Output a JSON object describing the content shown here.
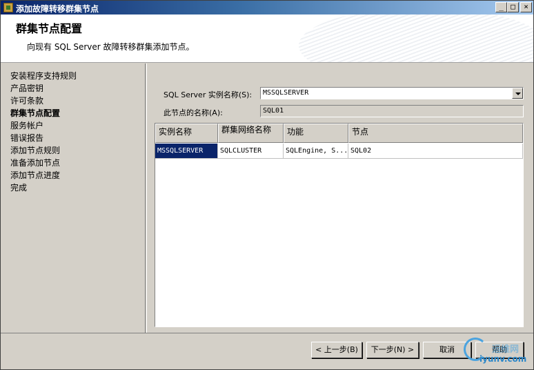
{
  "window": {
    "title": "添加故障转移群集节点"
  },
  "header": {
    "title": "群集节点配置",
    "subtitle": "向现有 SQL Server 故障转移群集添加节点。"
  },
  "nav": {
    "items": [
      {
        "label": "安装程序支持规则"
      },
      {
        "label": "产品密钥"
      },
      {
        "label": "许可条款"
      },
      {
        "label": "群集节点配置",
        "active": true
      },
      {
        "label": "服务帐户"
      },
      {
        "label": "错误报告"
      },
      {
        "label": "添加节点规则"
      },
      {
        "label": "准备添加节点"
      },
      {
        "label": "添加节点进度"
      },
      {
        "label": "完成"
      }
    ]
  },
  "form": {
    "instance_label": "SQL Server 实例名称(S):",
    "instance_value": "MSSQLSERVER",
    "node_name_label": "此节点的名称(A):",
    "node_name_value": "SQL01"
  },
  "grid": {
    "columns": [
      "实例名称",
      "群集网络名称",
      "功能",
      "节点"
    ],
    "rows": [
      [
        "MSSQLSERVER",
        "SQLCLUSTER",
        "SQLEngine, S...",
        "SQL02"
      ]
    ]
  },
  "buttons": {
    "back": "< 上一步(B)",
    "next": "下一步(N) >",
    "cancel": "取消",
    "help": "帮助"
  },
  "watermark": {
    "top": "运维网",
    "bottom": "iyunv.com"
  },
  "colors": {
    "selection": "#0a246a",
    "face": "#d4d0c8"
  }
}
